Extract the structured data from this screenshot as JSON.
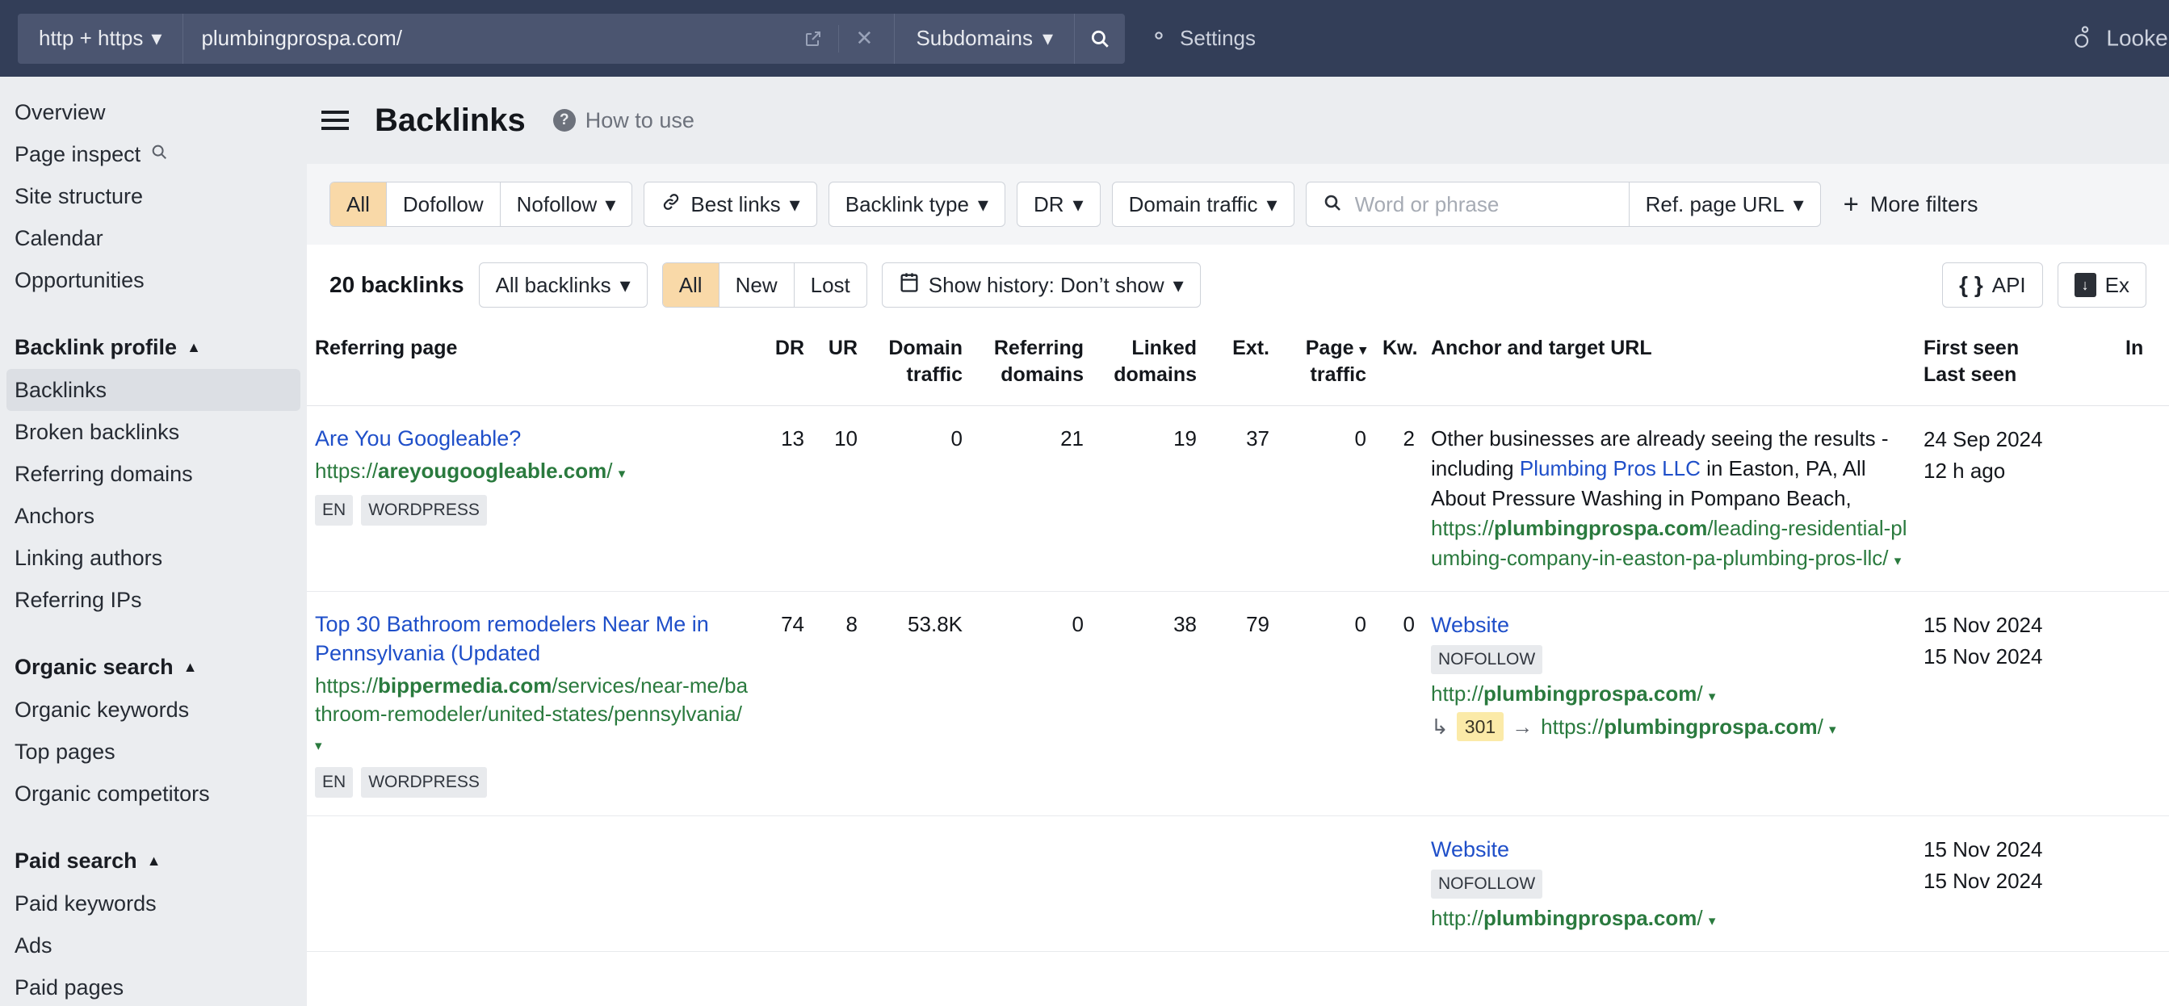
{
  "topbar": {
    "protocol_select": "http + https",
    "url_value": "plumbingprospa.com/",
    "external_icon": "external-link-icon",
    "clear_icon": "close-icon",
    "scope_select": "Subdomains",
    "search_icon": "search-icon",
    "settings_label": "Settings",
    "settings_icon": "gear-icon",
    "looker_label": "Looker",
    "looker_icon": "looker-icon"
  },
  "sidebar": {
    "items": [
      {
        "label": "Overview",
        "type": "link",
        "active": false
      },
      {
        "label": "Page inspect",
        "type": "link",
        "active": false,
        "icon": "search-icon"
      },
      {
        "label": "Site structure",
        "type": "link",
        "active": false
      },
      {
        "label": "Calendar",
        "type": "link",
        "active": false
      },
      {
        "label": "Opportunities",
        "type": "link",
        "active": false
      }
    ],
    "groups": [
      {
        "title": "Backlink profile",
        "items": [
          {
            "label": "Backlinks",
            "active": true
          },
          {
            "label": "Broken backlinks",
            "active": false
          },
          {
            "label": "Referring domains",
            "active": false
          },
          {
            "label": "Anchors",
            "active": false
          },
          {
            "label": "Linking authors",
            "active": false
          },
          {
            "label": "Referring IPs",
            "active": false
          }
        ]
      },
      {
        "title": "Organic search",
        "items": [
          {
            "label": "Organic keywords",
            "active": false
          },
          {
            "label": "Top pages",
            "active": false
          },
          {
            "label": "Organic competitors",
            "active": false
          }
        ]
      },
      {
        "title": "Paid search",
        "items": [
          {
            "label": "Paid keywords",
            "active": false
          },
          {
            "label": "Ads",
            "active": false
          },
          {
            "label": "Paid pages",
            "active": false
          }
        ]
      }
    ]
  },
  "header": {
    "title": "Backlinks",
    "how_to_use": "How to use",
    "menu_icon": "hamburger-icon",
    "help_icon": "question-mark-icon"
  },
  "filters": {
    "follow_segment": [
      {
        "label": "All",
        "selected": true
      },
      {
        "label": "Dofollow",
        "selected": false
      },
      {
        "label": "Nofollow",
        "selected": false,
        "caret": true
      }
    ],
    "best_links": "Best links",
    "best_links_icon": "link-chain-icon",
    "backlink_type": "Backlink type",
    "dr": "DR",
    "domain_traffic": "Domain traffic",
    "search_placeholder": "Word or phrase",
    "search_value": "",
    "search_icon": "search-icon",
    "ref_page_url": "Ref. page URL",
    "more_filters": "More filters",
    "plus_icon": "plus-icon"
  },
  "toolbar": {
    "count": "20 backlinks",
    "all_backlinks": "All backlinks",
    "state_segment": [
      {
        "label": "All",
        "selected": true
      },
      {
        "label": "New",
        "selected": false
      },
      {
        "label": "Lost",
        "selected": false
      }
    ],
    "show_history": "Show history: Don’t show",
    "history_icon": "calendar-icon",
    "api_label": "API",
    "api_icon": "braces-icon",
    "export_label": "Ex",
    "export_icon": "download-file-icon"
  },
  "table": {
    "columns": [
      {
        "key": "referring_page",
        "label": "Referring page",
        "align": "left"
      },
      {
        "key": "dr",
        "label": "DR",
        "align": "right"
      },
      {
        "key": "ur",
        "label": "UR",
        "align": "right"
      },
      {
        "key": "domain_traffic",
        "label": "Domain traffic",
        "align": "right"
      },
      {
        "key": "referring_domains",
        "label": "Referring domains",
        "align": "right"
      },
      {
        "key": "linked_domains",
        "label": "Linked domains",
        "align": "right"
      },
      {
        "key": "ext",
        "label": "Ext.",
        "align": "right"
      },
      {
        "key": "page_traffic",
        "label": "Page traffic",
        "align": "right",
        "sorted": true
      },
      {
        "key": "kw",
        "label": "Kw.",
        "align": "right"
      },
      {
        "key": "anchor",
        "label": "Anchor and target URL",
        "align": "left"
      },
      {
        "key": "seen",
        "label": "First seen Last seen",
        "align": "left"
      },
      {
        "key": "in",
        "label": "In",
        "align": "left"
      }
    ],
    "column_labels": {
      "referring_page": "Referring page",
      "dr": "DR",
      "ur": "UR",
      "domain_traffic_1": "Domain",
      "domain_traffic_2": "traffic",
      "referring_domains_1": "Referring",
      "referring_domains_2": "domains",
      "linked_domains_1": "Linked",
      "linked_domains_2": "domains",
      "ext": "Ext.",
      "page_traffic_1": "Page",
      "page_traffic_2": "traffic",
      "kw": "Kw.",
      "anchor": "Anchor and target URL",
      "first_seen": "First seen",
      "last_seen": "Last seen",
      "in": "In"
    },
    "rows": [
      {
        "title": "Are You Googleable?",
        "url_scheme": "https://",
        "url_domain": "areyougoogleable.com",
        "url_path": "/",
        "tags": [
          "EN",
          "WORDPRESS"
        ],
        "dr": "13",
        "ur": "10",
        "domain_traffic": "0",
        "referring_domains": "21",
        "linked_domains": "19",
        "ext": "37",
        "page_traffic": "0",
        "kw": "2",
        "anchor_pre": "Other businesses are already seeing the results - including ",
        "anchor_link": "Plumbing Pros LLC",
        "anchor_post": " in Easton, PA, All About Pressure Washing in Pompano Beach,",
        "target_scheme": "https://",
        "target_domain": "plumbingprospa.com",
        "target_path": "/leading-residential-plumbing-company-in-easton-pa-plumbing-pros-llc/",
        "nofollow": false,
        "redirect": null,
        "first_seen": "24 Sep 2024",
        "last_seen": "12 h ago"
      },
      {
        "title": "Top 30 Bathroom remodelers Near Me in Pennsylvania (Updated",
        "url_scheme": "https://",
        "url_domain": "bippermedia.com",
        "url_path": "/services/near-me/bathroom-remodeler/united-states/pennsylvania/",
        "tags": [
          "EN",
          "WORDPRESS"
        ],
        "dr": "74",
        "ur": "8",
        "domain_traffic": "53.8K",
        "referring_domains": "0",
        "linked_domains": "38",
        "ext": "79",
        "page_traffic": "0",
        "kw": "0",
        "anchor_link_only": "Website",
        "nofollow": true,
        "nofollow_label": "NOFOLLOW",
        "target_scheme": "http://",
        "target_domain": "plumbingprospa.com",
        "target_path": "/",
        "redirect": {
          "code": "301",
          "scheme": "https://",
          "domain": "plumbingprospa.com",
          "path": "/"
        },
        "first_seen": "15 Nov 2024",
        "last_seen": "15 Nov 2024"
      },
      {
        "title": "",
        "anchor_link_only": "Website",
        "nofollow": true,
        "nofollow_label": "NOFOLLOW",
        "target_scheme": "http://",
        "target_domain": "plumbingprospa.com",
        "target_path": "/",
        "redirect": null,
        "first_seen": "15 Nov 2024",
        "last_seen": "15 Nov 2024"
      }
    ]
  },
  "colors": {
    "topbar_bg": "#333e58",
    "sidebar_bg": "#ebedf0",
    "accent_selected": "#f9d9a8",
    "link_blue": "#1f4fc9",
    "url_green": "#2a7a3e",
    "code_badge": "#fbeaa8"
  }
}
